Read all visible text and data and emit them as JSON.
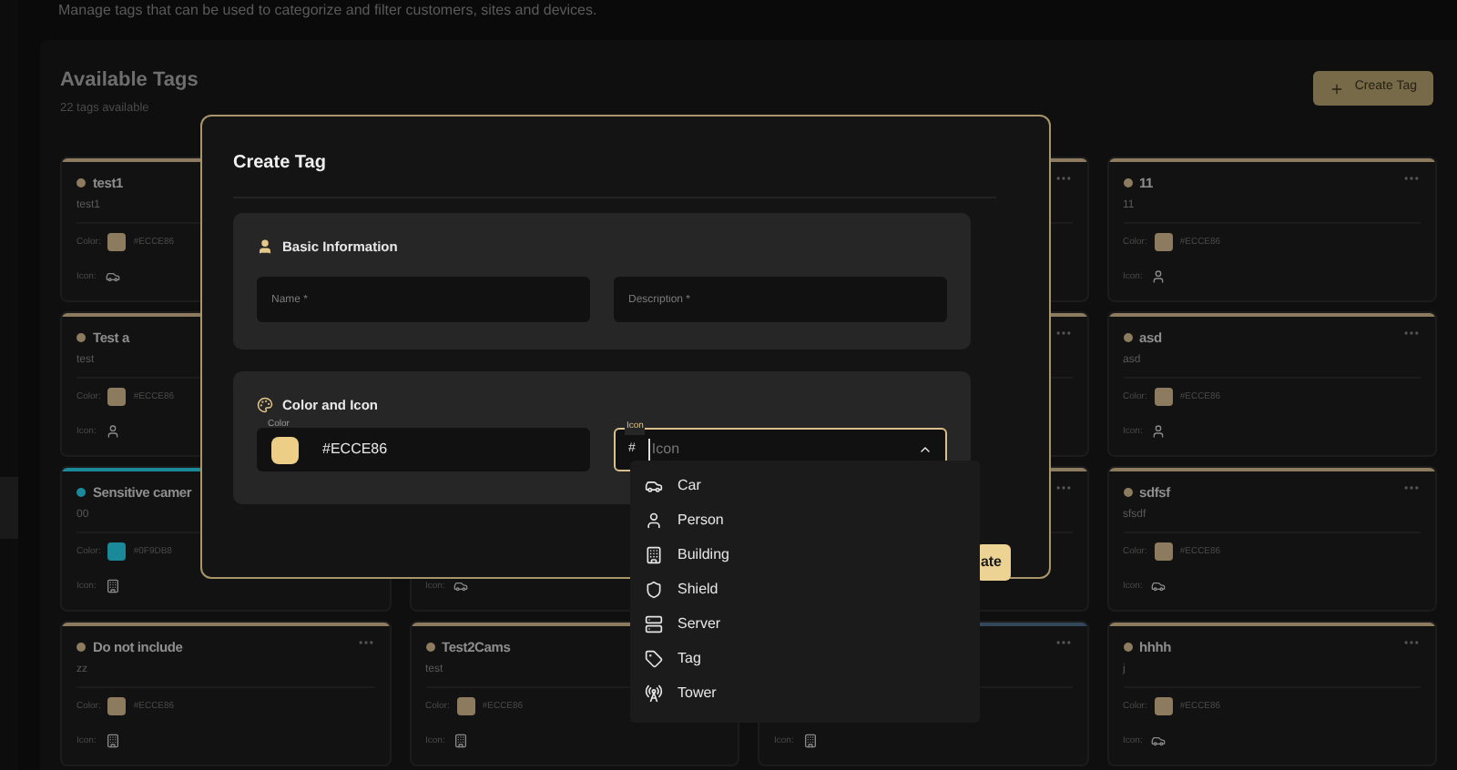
{
  "page": {
    "description": "Manage tags that can be used to categorize and filter customers, sites and devices."
  },
  "panel": {
    "title": "Available Tags",
    "subtitle": "22 tags available",
    "create_button": {
      "label": "Create Tag"
    }
  },
  "cards": [
    {
      "name": "test1",
      "description": "test1",
      "color": "#8c7b5e",
      "color_row": {
        "label": "Color:",
        "value": "#ECCE86"
      },
      "icon_row": {
        "label": "Icon:",
        "kind": "car"
      }
    },
    {
      "color": "#8c7b5e"
    },
    {
      "name": "11",
      "description": "11",
      "color": "#8c7b5e",
      "color_row": {
        "label": "Color:",
        "value": "#ECCE86"
      },
      "icon_row": {
        "label": "Icon:",
        "kind": "person"
      }
    },
    {
      "name": "Test a",
      "description": "test",
      "color": "#8c7b5e",
      "color_row": {
        "label": "Color:",
        "value": "#ECCE86"
      },
      "icon_row": {
        "label": "Icon:",
        "kind": "person"
      }
    },
    {
      "color": "#8c7b5e"
    },
    {
      "name": "asd",
      "description": "asd",
      "color": "#8c7b5e",
      "color_row": {
        "label": "Color:",
        "value": "#ECCE86"
      },
      "icon_row": {
        "label": "Icon:",
        "kind": "person"
      }
    },
    {
      "name": "Sensitive camer",
      "description": "00",
      "color": "#1a8a9a",
      "color_row": {
        "label": "Color:",
        "value": "#0F9DB8"
      },
      "icon_row": {
        "label": "Icon:",
        "kind": "building"
      }
    },
    {
      "icon_row": {
        "label": "Icon:",
        "kind": "car"
      }
    },
    {
      "color": "#8c7b5e"
    },
    {
      "name": "sdfsf",
      "description": "sfsdf",
      "color": "#8c7b5e",
      "color_row": {
        "label": "Color:",
        "value": "#ECCE86"
      },
      "icon_row": {
        "label": "Icon:",
        "kind": "car"
      }
    },
    {
      "name": "Do not include",
      "description": "zz",
      "color": "#8c7b5e",
      "color_row": {
        "label": "Color:",
        "value": "#ECCE86"
      },
      "icon_row": {
        "label": "Icon:",
        "kind": "building"
      }
    },
    {
      "name": "Test2Cams",
      "description": "test",
      "color": "#8c7b5e",
      "color_row": {
        "label": "Color:",
        "value": "#ECCE86"
      },
      "icon_row": {
        "label": "Icon:",
        "kind": "building"
      }
    },
    {
      "color": "#34465a",
      "icon_row": {
        "label": "Icon:",
        "kind": "building"
      }
    },
    {
      "name": "hhhh",
      "description": "j",
      "color": "#8c7b5e",
      "color_row": {
        "label": "Color:",
        "value": "#ECCE86"
      },
      "icon_row": {
        "label": "Icon:",
        "kind": "car"
      }
    }
  ],
  "dialog": {
    "title": "Create Tag",
    "basic": {
      "title": "Basic Information",
      "fields": [
        {
          "placeholder": "Name *"
        },
        {
          "placeholder": "Description *"
        }
      ]
    },
    "color_icon": {
      "title": "Color and Icon",
      "color_field": {
        "label": "Color",
        "value": "#ECCE86"
      },
      "icon_field": {
        "label": "Icon",
        "prefix": "#",
        "placeholder": "Icon",
        "expanded": true
      }
    },
    "create_button": {
      "label": "ate"
    }
  },
  "dropdown": {
    "options": [
      {
        "label": "Car",
        "kind": "car"
      },
      {
        "label": "Person",
        "kind": "person"
      },
      {
        "label": "Building",
        "kind": "building"
      },
      {
        "label": "Shield",
        "kind": "shield"
      },
      {
        "label": "Server",
        "kind": "server"
      },
      {
        "label": "Tag",
        "kind": "tag"
      },
      {
        "label": "Tower",
        "kind": "tower"
      }
    ]
  }
}
